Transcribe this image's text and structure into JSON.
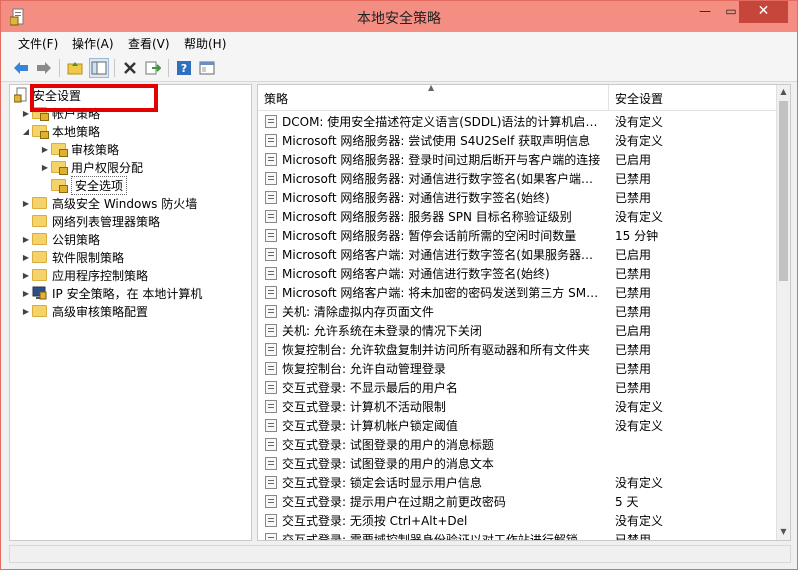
{
  "window": {
    "title": "本地安全策略"
  },
  "menu": [
    "文件(F)",
    "操作(A)",
    "查看(V)",
    "帮助(H)"
  ],
  "tree": [
    {
      "label": "安全设置",
      "level": 0,
      "arrow": "",
      "lock": false
    },
    {
      "label": "帐户策略",
      "level": 1,
      "arrow": "▶",
      "lock": true
    },
    {
      "label": "本地策略",
      "level": 1,
      "arrow": "◢",
      "lock": true
    },
    {
      "label": "审核策略",
      "level": 2,
      "arrow": "▶",
      "lock": true
    },
    {
      "label": "用户权限分配",
      "level": 2,
      "arrow": "▶",
      "lock": true
    },
    {
      "label": "安全选项",
      "level": 2,
      "arrow": "",
      "lock": true,
      "selected": true
    },
    {
      "label": "高级安全 Windows 防火墙",
      "level": 1,
      "arrow": "▶",
      "lock": false
    },
    {
      "label": "网络列表管理器策略",
      "level": 1,
      "arrow": "",
      "lock": false
    },
    {
      "label": "公钥策略",
      "level": 1,
      "arrow": "▶",
      "lock": false
    },
    {
      "label": "软件限制策略",
      "level": 1,
      "arrow": "▶",
      "lock": false
    },
    {
      "label": "应用程序控制策略",
      "level": 1,
      "arrow": "▶",
      "lock": false
    },
    {
      "label": "IP 安全策略，在 本地计算机",
      "level": 1,
      "arrow": "▶",
      "lock": false
    },
    {
      "label": "高级审核策略配置",
      "level": 1,
      "arrow": "▶",
      "lock": false
    }
  ],
  "columns": {
    "policy": "策略",
    "setting": "安全设置"
  },
  "rows": [
    {
      "name": "DCOM: 使用安全描述符定义语言(SDDL)语法的计算机启动...",
      "value": "没有定义"
    },
    {
      "name": "Microsoft 网络服务器: 尝试使用 S4U2Self 获取声明信息",
      "value": "没有定义"
    },
    {
      "name": "Microsoft 网络服务器: 登录时间过期后断开与客户端的连接",
      "value": "已启用"
    },
    {
      "name": "Microsoft 网络服务器: 对通信进行数字签名(如果客户端允...",
      "value": "已禁用"
    },
    {
      "name": "Microsoft 网络服务器: 对通信进行数字签名(始终)",
      "value": "已禁用"
    },
    {
      "name": "Microsoft 网络服务器: 服务器 SPN 目标名称验证级别",
      "value": "没有定义"
    },
    {
      "name": "Microsoft 网络服务器: 暂停会话前所需的空闲时间数量",
      "value": "15 分钟"
    },
    {
      "name": "Microsoft 网络客户端: 对通信进行数字签名(如果服务器允...",
      "value": "已启用"
    },
    {
      "name": "Microsoft 网络客户端: 对通信进行数字签名(始终)",
      "value": "已禁用"
    },
    {
      "name": "Microsoft 网络客户端: 将未加密的密码发送到第三方 SMB...",
      "value": "已禁用"
    },
    {
      "name": "关机: 清除虚拟内存页面文件",
      "value": "已禁用"
    },
    {
      "name": "关机: 允许系统在未登录的情况下关闭",
      "value": "已启用"
    },
    {
      "name": "恢复控制台: 允许软盘复制并访问所有驱动器和所有文件夹",
      "value": "已禁用"
    },
    {
      "name": "恢复控制台: 允许自动管理登录",
      "value": "已禁用"
    },
    {
      "name": "交互式登录: 不显示最后的用户名",
      "value": "已禁用"
    },
    {
      "name": "交互式登录: 计算机不活动限制",
      "value": "没有定义"
    },
    {
      "name": "交互式登录: 计算机帐户锁定阈值",
      "value": "没有定义"
    },
    {
      "name": "交互式登录: 试图登录的用户的消息标题",
      "value": ""
    },
    {
      "name": "交互式登录: 试图登录的用户的消息文本",
      "value": ""
    },
    {
      "name": "交互式登录: 锁定会话时显示用户信息",
      "value": "没有定义"
    },
    {
      "name": "交互式登录: 提示用户在过期之前更改密码",
      "value": "5 天"
    },
    {
      "name": "交互式登录: 无须按 Ctrl+Alt+Del",
      "value": "没有定义"
    },
    {
      "name": "交互式登录: 需要域控制器身份验证以对工作站进行解锁",
      "value": "已禁用"
    }
  ],
  "window_buttons": {
    "minimize": "—",
    "maximize": "▭",
    "close": "✕"
  },
  "icons": {
    "back": "back-arrow-icon",
    "forward": "forward-arrow-icon",
    "up": "up-folder-icon",
    "show-tree": "show-tree-icon",
    "delete": "delete-icon",
    "export": "export-list-icon",
    "help": "help-icon",
    "properties": "properties-icon"
  },
  "colors": {
    "titlebar": "#f48e82",
    "close_button": "#c7463b",
    "highlight_box": "#e40000"
  }
}
